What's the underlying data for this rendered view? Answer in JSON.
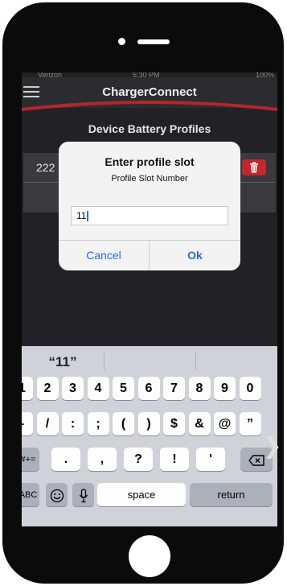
{
  "status_bar": {
    "carrier": "Verizon",
    "time": "5:30 PM",
    "battery": "100%"
  },
  "app": {
    "title": "ChargerConnect"
  },
  "section": {
    "title": "Device Battery Profiles"
  },
  "profiles": [
    {
      "name": "222"
    }
  ],
  "dialog": {
    "title": "Enter profile slot",
    "message": "Profile Slot Number",
    "input_value": "11",
    "cancel_label": "Cancel",
    "ok_label": "Ok"
  },
  "keyboard": {
    "suggestion": "“11”",
    "row1": [
      "1",
      "2",
      "3",
      "4",
      "5",
      "6",
      "7",
      "8",
      "9",
      "0"
    ],
    "row2": [
      "-",
      "/",
      ":",
      ";",
      "(",
      ")",
      "$",
      "&",
      "@",
      "”"
    ],
    "row3": [
      ".",
      ",",
      "?",
      "!",
      "'"
    ],
    "symbols_label": "#+=",
    "abc_label": "ABC",
    "space_label": "space",
    "return_label": "return"
  },
  "colors": {
    "accent": "#c1272d",
    "link": "#2a6ae0"
  }
}
